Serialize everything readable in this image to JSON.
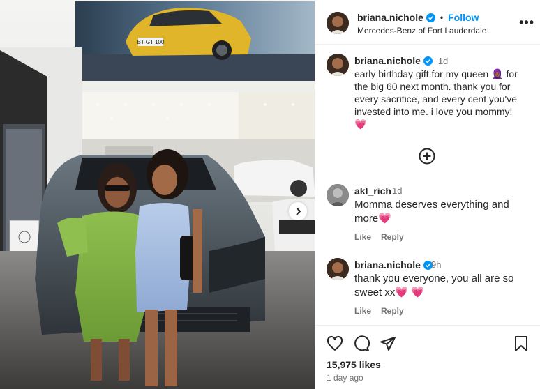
{
  "post": {
    "username": "briana.nichole",
    "follow_label": "Follow",
    "location": "Mercedes-Benz of Fort Lauderdale",
    "more_label": "•••",
    "caption_time": "1d",
    "caption_text": "early birthday gift for my queen 🤷🏾‍♀️ for the big 60 next month. thank you for every sacrifice, and every cent you've invested into me. i love you mommy! 💗",
    "caption_emoji_1": "🧕🏾",
    "caption_part_1": "early birthday gift for my queen",
    "caption_part_2": "for the big 60 next month. thank you for every sacrifice, and every cent you've invested into me. i love you mommy!",
    "caption_emoji_2": "💗",
    "comments": [
      {
        "username": "akl_rich",
        "time": "1d",
        "text": "Momma deserves everything and more",
        "emoji": "💗",
        "like_label": "Like",
        "reply_label": "Reply"
      },
      {
        "username": "briana.nichole",
        "time": "9h",
        "text": "thank you everyone, you all are so sweet xx",
        "emoji": "💗 💗",
        "like_label": "Like",
        "reply_label": "Reply"
      }
    ],
    "likes": "15,975 likes",
    "posted_ago": "1 day ago",
    "plate_text": "BT GT 100"
  },
  "colors": {
    "link_blue": "#0095f6",
    "text": "#262626",
    "muted": "#737373",
    "verified": "#0095f6",
    "heart": "#e0245e"
  },
  "icons": [
    "heart-icon",
    "comment-icon",
    "share-icon",
    "bookmark-icon",
    "add-comments-icon",
    "verified-icon",
    "chevron-right-icon",
    "more-options-icon"
  ]
}
